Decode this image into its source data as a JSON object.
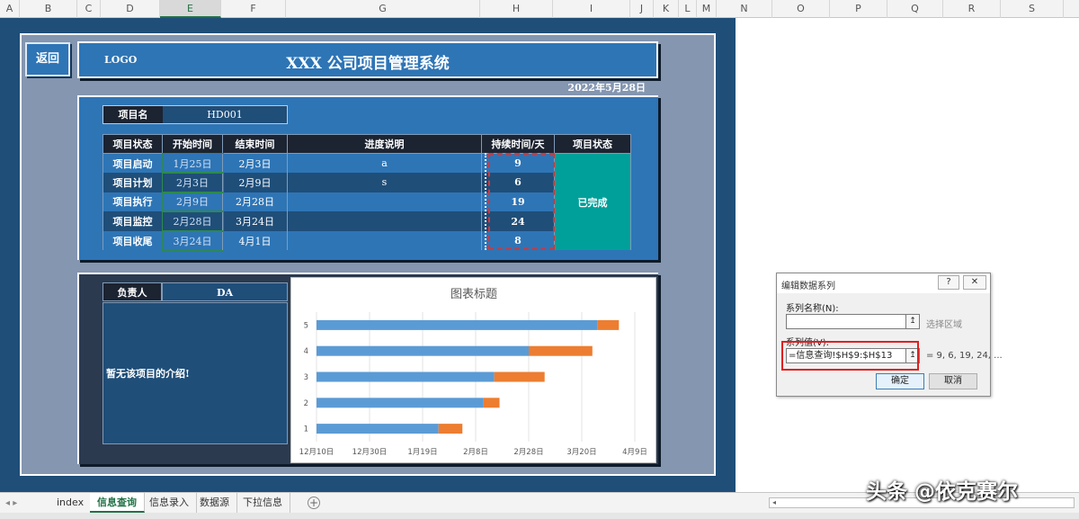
{
  "columns": [
    "A",
    "B",
    "C",
    "D",
    "E",
    "F",
    "G",
    "H",
    "I",
    "J",
    "K",
    "L",
    "M",
    "N",
    "O",
    "P",
    "Q",
    "R",
    "S"
  ],
  "selected_column": "E",
  "back_button": "返回",
  "header": {
    "logo": "LOGO",
    "title": "XXX 公司项目管理系统",
    "date": "2022年5月28日"
  },
  "project": {
    "name_label": "项目名",
    "name_value": "HD001"
  },
  "table": {
    "headers": [
      "项目状态",
      "开始时间",
      "结束时间",
      "进度说明",
      "持续时间/天",
      "项目状态"
    ],
    "rows": [
      {
        "phase": "项目启动",
        "start": "1月25日",
        "end": "2月3日",
        "note": "a",
        "days": "9"
      },
      {
        "phase": "项目计划",
        "start": "2月3日",
        "end": "2月9日",
        "note": "s",
        "days": "6"
      },
      {
        "phase": "项目执行",
        "start": "2月9日",
        "end": "2月28日",
        "note": "",
        "days": "19"
      },
      {
        "phase": "项目监控",
        "start": "2月28日",
        "end": "3月24日",
        "note": "",
        "days": "24"
      },
      {
        "phase": "项目收尾",
        "start": "3月24日",
        "end": "4月1日",
        "note": "",
        "days": "8"
      }
    ],
    "status": "已完成"
  },
  "owner": {
    "label": "负责人",
    "value": "DA",
    "intro": "暂无该项目的介绍!"
  },
  "chart_data": {
    "type": "bar",
    "orientation": "horizontal",
    "stacked": true,
    "title": "图表标题",
    "categories": [
      "1",
      "2",
      "3",
      "4",
      "5"
    ],
    "x_ticks": [
      "12月10日",
      "12月30日",
      "1月19日",
      "2月8日",
      "2月28日",
      "3月20日",
      "4月9日"
    ],
    "x_tick_days": [
      0,
      20,
      40,
      60,
      80,
      100,
      120
    ],
    "xlim_days": [
      0,
      120
    ],
    "series": [
      {
        "values_days": [
          46,
          63,
          67,
          80,
          106
        ],
        "color": "#5b9bd5"
      },
      {
        "values_days": [
          9,
          6,
          19,
          24,
          8
        ],
        "color": "#ed7d31"
      }
    ],
    "grid": true
  },
  "dialog": {
    "title": "编辑数据系列",
    "help": "?",
    "close": "✕",
    "name_label": "系列名称(N):",
    "name_value": "",
    "name_hint": "选择区域",
    "values_label": "系列值(V):",
    "values_value": "=信息查询!$H$9:$H$13",
    "values_preview": "= 9, 6, 19, 24, ...",
    "ok": "确定",
    "cancel": "取消",
    "collapse_icon": "↥"
  },
  "tabs": {
    "items": [
      "index",
      "信息查询",
      "信息录入",
      "数据源",
      "下拉信息"
    ],
    "active": 1,
    "add": "+",
    "nav": "◂  ▸"
  },
  "watermark": "头条 @依克赛尔"
}
